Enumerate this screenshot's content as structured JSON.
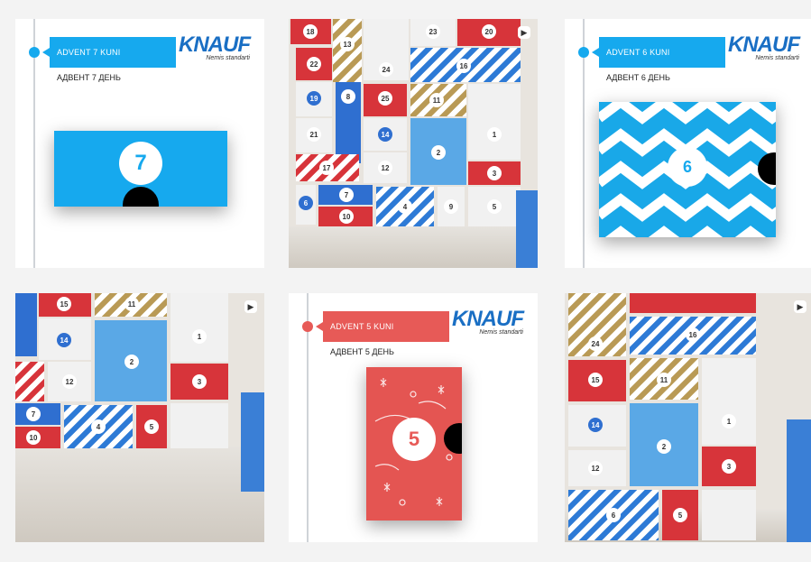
{
  "posts": [
    {
      "type": "info",
      "banner": "ADVENT 7 KUNI",
      "subtitle": "АДВЕНТ 7 ДЕНЬ",
      "number": "7",
      "accent": "#16a9ee",
      "logo": "KNAUF",
      "tagline": "Nemis standarti"
    },
    {
      "type": "photo",
      "icon": "video-icon"
    },
    {
      "type": "info",
      "banner": "ADVENT 6 KUNI",
      "subtitle": "АДВЕНТ 6 ДЕНЬ",
      "number": "6",
      "accent": "#16a9ee",
      "logo": "KNAUF",
      "tagline": "Nemis standarti"
    },
    {
      "type": "photo",
      "icon": "video-icon"
    },
    {
      "type": "info",
      "banner": "ADVENT 5 KUNI",
      "subtitle": "АДВЕНТ 5 ДЕНЬ",
      "number": "5",
      "accent": "#e75a57",
      "logo": "KNAUF",
      "tagline": "Nemis standarti"
    },
    {
      "type": "photo",
      "icon": "video-icon"
    }
  ],
  "photo_numbers": {
    "a": [
      "18",
      "13",
      "23",
      "20",
      "22",
      "24",
      "16",
      "19",
      "8",
      "25",
      "21",
      "11",
      "1",
      "14",
      "17",
      "12",
      "2",
      "3",
      "6",
      "7",
      "4",
      "9",
      "10",
      "5"
    ],
    "b": [
      "15",
      "11",
      "14",
      "1",
      "2",
      "12",
      "3",
      "7",
      "10",
      "4",
      "5"
    ],
    "c": [
      "24",
      "16",
      "15",
      "11",
      "14",
      "1",
      "2",
      "12",
      "3",
      "6",
      "5"
    ]
  },
  "colors": {
    "knauf_blue": "#1a6fc4",
    "zigzag_blue": "#16a9ee",
    "advent_red": "#e75a57"
  }
}
